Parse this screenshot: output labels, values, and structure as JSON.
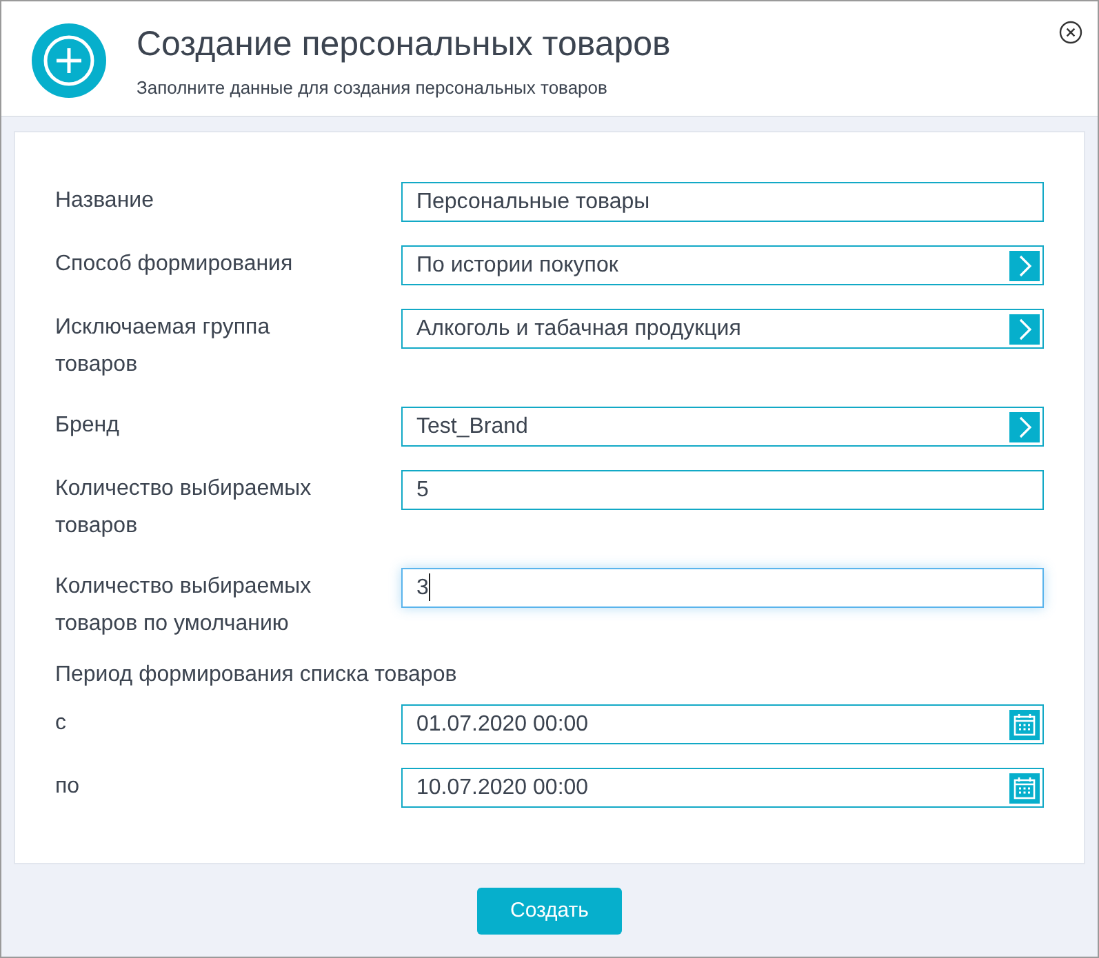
{
  "dialog": {
    "title": "Создание персональных товаров",
    "subtitle": "Заполните данные для создания персональных товаров"
  },
  "form": [
    {
      "kind": "text",
      "label": "Название",
      "value": "Персональные товары",
      "focused": false
    },
    {
      "kind": "select",
      "label": "Способ формирования",
      "value": "По истории покупок",
      "focused": false
    },
    {
      "kind": "select",
      "label": "Исключаемая группа товаров",
      "value": "Алкоголь и табачная продукция",
      "focused": false
    },
    {
      "kind": "select",
      "label": "Бренд",
      "value": "Test_Brand",
      "focused": false
    },
    {
      "kind": "text",
      "label": "Количество выбираемых товаров",
      "value": "5",
      "focused": false
    },
    {
      "kind": "text",
      "label": "Количество выбираемых товаров по умолчанию",
      "value": "3",
      "focused": true
    },
    {
      "kind": "heading",
      "label": "Период формирования списка товаров"
    },
    {
      "kind": "date",
      "label": "с",
      "value": "01.07.2020 00:00",
      "focused": false
    },
    {
      "kind": "date",
      "label": "по",
      "value": "10.07.2020 00:00",
      "focused": false
    }
  ],
  "buttons": [
    {
      "label": "Создать"
    }
  ]
}
